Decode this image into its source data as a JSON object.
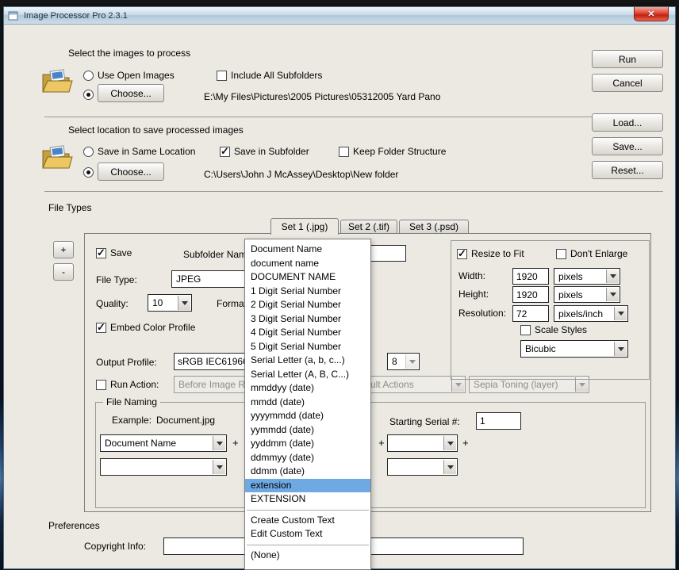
{
  "window": {
    "title": "Image Processor Pro 2.3.1"
  },
  "icons": {
    "close": "✕"
  },
  "actions": {
    "run": "Run",
    "cancel": "Cancel",
    "load": "Load...",
    "save": "Save...",
    "reset": "Reset..."
  },
  "source": {
    "heading": "Select the images to process",
    "use_open_images": "Use Open Images",
    "include_all_subfolders": "Include All Subfolders",
    "choose": "Choose...",
    "path": "E:\\My Files\\Pictures\\2005 Pictures\\05312005 Yard Pano"
  },
  "destination": {
    "heading": "Select location to save processed images",
    "save_in_same_location": "Save in Same Location",
    "save_in_subfolder": "Save in Subfolder",
    "keep_folder_structure": "Keep Folder Structure",
    "choose": "Choose...",
    "path": "C:\\Users\\John J McAssey\\Desktop\\New folder"
  },
  "file_types": {
    "heading": "File Types",
    "tabs": [
      {
        "label": "Set 1 (.jpg)"
      },
      {
        "label": "Set 2 (.tif)"
      },
      {
        "label": "Set 3 (.psd)"
      }
    ],
    "add": "+",
    "remove": "-"
  },
  "set_panel": {
    "save": "Save",
    "subfolder_label": "Subfolder Name:",
    "subfolder_value": "",
    "file_type_label": "File Type:",
    "file_type_value": "JPEG",
    "quality_label": "Quality:",
    "quality_value": "10",
    "format_label": "Format",
    "embed_color_profile": "Embed Color Profile",
    "output_profile_label": "Output Profile:",
    "output_profile_value": "sRGB IEC61966",
    "bit_depth_value": "8",
    "run_action": "Run Action:",
    "run_action_value": "Before Image R",
    "action_set_value": "ult Actions",
    "action_value": "Sepia Toning (layer)"
  },
  "resize": {
    "resize_to_fit": "Resize to Fit",
    "dont_enlarge": "Don't Enlarge",
    "width_label": "Width:",
    "width_value": "1920",
    "width_unit": "pixels",
    "height_label": "Height:",
    "height_value": "1920",
    "height_unit": "pixels",
    "resolution_label": "Resolution:",
    "resolution_value": "72",
    "resolution_unit": "pixels/inch",
    "scale_styles": "Scale Styles",
    "interpolation": "Bicubic"
  },
  "file_naming": {
    "heading": "File Naming",
    "example_label": "Example:",
    "example_value": "Document.jpg",
    "starting_serial_label": "Starting Serial #:",
    "starting_serial_value": "1",
    "field1_value": "Document Name",
    "plus": "+"
  },
  "naming_menu": {
    "items": [
      {
        "label": "Document Name"
      },
      {
        "label": "document name"
      },
      {
        "label": "DOCUMENT NAME"
      },
      {
        "label": "1 Digit Serial Number"
      },
      {
        "label": "2 Digit Serial Number"
      },
      {
        "label": "3 Digit Serial Number"
      },
      {
        "label": "4 Digit Serial Number"
      },
      {
        "label": "5 Digit Serial Number"
      },
      {
        "label": "Serial Letter (a, b, c...)"
      },
      {
        "label": "Serial Letter (A, B, C...)"
      },
      {
        "label": "mmddyy (date)"
      },
      {
        "label": "mmdd (date)"
      },
      {
        "label": "yyyymmdd (date)"
      },
      {
        "label": "yymmdd (date)"
      },
      {
        "label": "yyddmm (date)"
      },
      {
        "label": "ddmmyy (date)"
      },
      {
        "label": "ddmm (date)"
      },
      {
        "label": "extension",
        "highlighted": true
      },
      {
        "label": "EXTENSION"
      },
      {
        "separator": true
      },
      {
        "label": "Create Custom Text"
      },
      {
        "label": "Edit Custom Text"
      },
      {
        "separator": true
      },
      {
        "label": "(None)"
      }
    ]
  },
  "preferences": {
    "heading": "Preferences",
    "copyright_label": "Copyright Info:",
    "copyright_value": ""
  }
}
